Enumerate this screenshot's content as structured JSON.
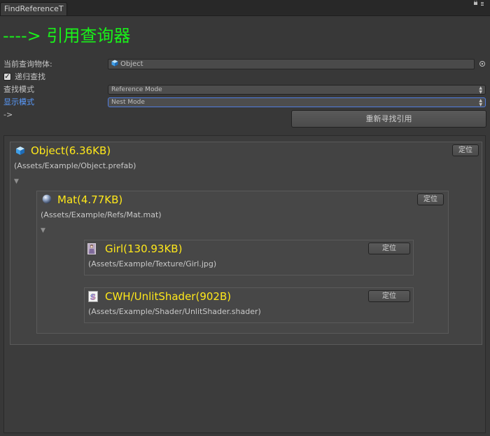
{
  "window": {
    "tab_title": "FindReferenceT",
    "window_controls_icon": "lock-and-menu-icon"
  },
  "header": {
    "title": "----> 引用查询器"
  },
  "form": {
    "current_object_label": "当前查询物体:",
    "current_object_value": "Object",
    "recursive": {
      "label": "递归查找",
      "checked": true
    },
    "search_mode_label": "查找模式",
    "search_mode_value": "Reference Mode",
    "display_mode_label": "显示模式",
    "display_mode_value": "Nest Mode",
    "arrow_text": "->",
    "research_button": "重新寻找引用"
  },
  "tree": {
    "root": {
      "icon": "prefab-cube-icon",
      "name": "Object(6.36KB)",
      "path": "(Assets/Example/Object.prefab)",
      "locate_label": "定位",
      "children": [
        {
          "icon": "material-sphere-icon",
          "name": "Mat(4.77KB)",
          "path": "(Assets/Example/Refs/Mat.mat)",
          "locate_label": "定位",
          "children": [
            {
              "icon": "texture-image-icon",
              "name": "Girl(130.93KB)",
              "path": "(Assets/Example/Texture/Girl.jpg)",
              "locate_label": "定位"
            },
            {
              "icon": "shader-icon",
              "name": "CWH/UnlitShader(902B)",
              "path": "(Assets/Example/Shader/UnlitShader.shader)",
              "locate_label": "定位"
            }
          ]
        }
      ]
    }
  },
  "colors": {
    "background": "#383838",
    "title_green": "#19f219",
    "asset_name_yellow": "#ffe81a",
    "display_mode_blue": "#5a9cff"
  }
}
